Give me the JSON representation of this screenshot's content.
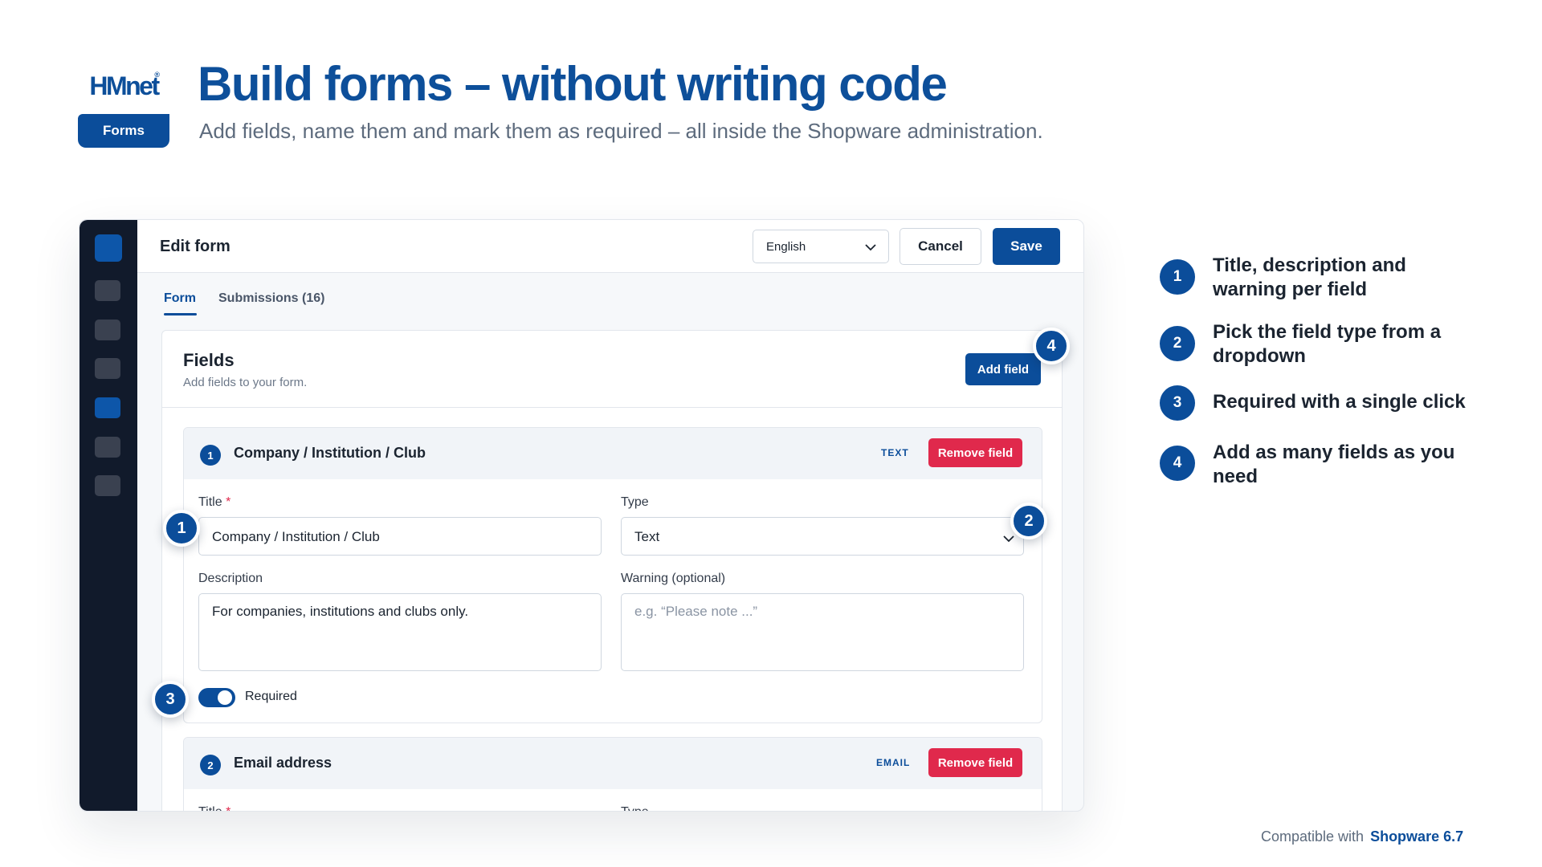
{
  "brand": {
    "logo_text": "HMnet",
    "logo_reg": "®",
    "badge": "Forms"
  },
  "hero": {
    "title": "Build forms – without writing code",
    "subtitle": "Add fields, name them and mark them as required – all inside the Shopware administration."
  },
  "topbar": {
    "title": "Edit form",
    "language": "English",
    "cancel_label": "Cancel",
    "save_label": "Save"
  },
  "tabs": [
    {
      "label": "Form"
    },
    {
      "label": "Submissions (16)"
    }
  ],
  "fields_card": {
    "title": "Fields",
    "subtitle": "Add fields to your form.",
    "add_label": "Add field"
  },
  "field_list": [
    {
      "number": "1",
      "name": "Company / Institution / Club",
      "type_tag": "TEXT",
      "remove_label": "Remove field",
      "title_label": "Title",
      "required_mark": "*",
      "title_value": "Company / Institution / Club",
      "type_label": "Type",
      "type_value": "Text",
      "description_label": "Description",
      "description_value": "For companies, institutions and clubs only.",
      "warning_label": "Warning (optional)",
      "warning_placeholder": "e.g. “Please note ...”",
      "required_label": "Required",
      "required_on": true
    },
    {
      "number": "2",
      "name": "Email address",
      "type_tag": "EMAIL",
      "remove_label": "Remove field",
      "title_label": "Title",
      "required_mark": "*",
      "type_label": "Type"
    }
  ],
  "callouts": [
    "1",
    "2",
    "3",
    "4"
  ],
  "features": [
    {
      "number": "1",
      "line1": "Title, description and",
      "line2": "warning per field"
    },
    {
      "number": "2",
      "line1": "Pick the field type from a",
      "line2": "dropdown"
    },
    {
      "number": "3",
      "line1": "Required with a single click",
      "line2": ""
    },
    {
      "number": "4",
      "line1": "Add as many fields as you",
      "line2": "need"
    }
  ],
  "footer": {
    "compat_label": "Compatible with",
    "compat_product": "Shopware 6.7"
  },
  "colors": {
    "primary": "#0b4d9a",
    "danger": "#e0294c",
    "sidebar": "#111a2b"
  },
  "icons": [
    "chevron-down-icon",
    "sidebar-nav-icon"
  ]
}
